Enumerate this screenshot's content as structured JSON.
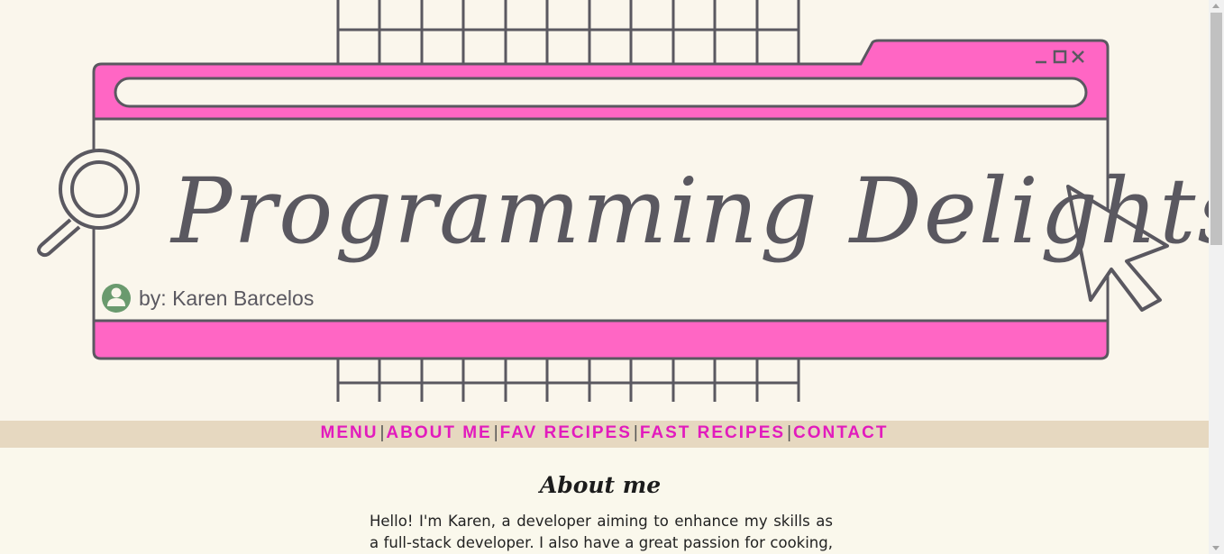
{
  "banner": {
    "title": "Programming Delights",
    "byline": "by: Karen Barcelos",
    "icons": [
      "magnifier-icon",
      "user-avatar-icon",
      "cursor-arrow-icon",
      "minimize-icon",
      "maximize-icon",
      "close-icon"
    ]
  },
  "nav": {
    "items": [
      "MENU",
      "ABOUT ME",
      "FAV RECIPES",
      "FAST RECIPES",
      "CONTACT"
    ],
    "separator": "|",
    "link_color": "#e21bbd",
    "bar_color": "#e6d8c0"
  },
  "about": {
    "heading": "About me",
    "text": "Hello! I'm Karen, a developer aiming to enhance my skills as a full-stack developer. I also have a great passion for cooking, and"
  },
  "colors": {
    "accent_pink": "#ff66c4",
    "line_gray": "#5a5860",
    "background": "#faf6ec"
  }
}
